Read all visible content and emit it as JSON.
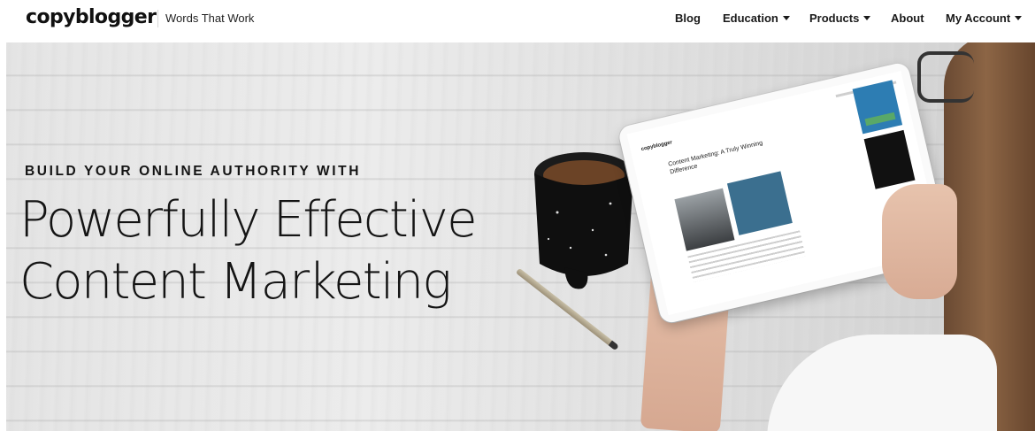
{
  "header": {
    "logo": "copyblogger",
    "tagline": "Words That Work",
    "nav": [
      {
        "label": "Blog",
        "has_dropdown": false
      },
      {
        "label": "Education",
        "has_dropdown": true
      },
      {
        "label": "Products",
        "has_dropdown": true
      },
      {
        "label": "About",
        "has_dropdown": false
      },
      {
        "label": "My Account",
        "has_dropdown": true
      }
    ]
  },
  "hero": {
    "eyebrow": "BUILD YOUR ONLINE AUTHORITY WITH",
    "headline_line1": "Powerfully Effective",
    "headline_line2": "Content Marketing"
  },
  "tablet_screen": {
    "logo": "copyblogger",
    "article_title": "Content Marketing: A Truly Winning Difference"
  },
  "colors": {
    "text": "#141414",
    "header_bg": "#ffffff",
    "accent_blue": "#2d7db3",
    "accent_green": "#59a868"
  }
}
